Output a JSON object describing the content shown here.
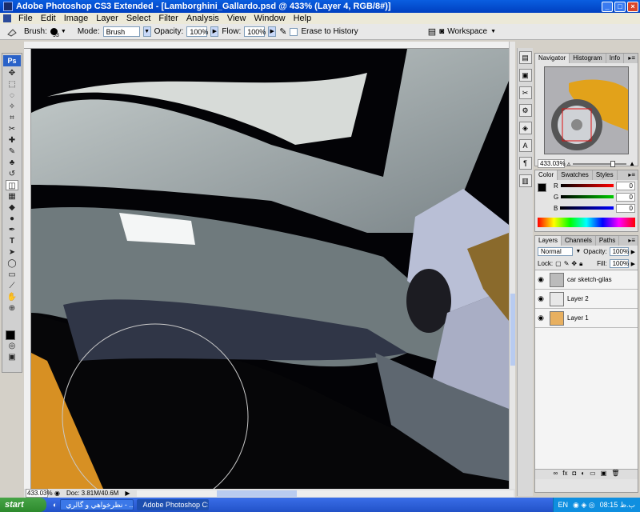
{
  "window": {
    "title": "Adobe Photoshop CS3 Extended - [Lamborghini_Gallardo.psd @ 433% (Layer 4, RGB/8#)]",
    "buttons": [
      "_",
      "□",
      "×"
    ]
  },
  "menu": [
    "File",
    "Edit",
    "Image",
    "Layer",
    "Select",
    "Filter",
    "Analysis",
    "View",
    "Window",
    "Help"
  ],
  "options": {
    "brush_label": "Brush:",
    "brush_size": "93",
    "mode_label": "Mode:",
    "mode_value": "Brush",
    "opacity_label": "Opacity:",
    "opacity_value": "100%",
    "flow_label": "Flow:",
    "flow_value": "100%",
    "erase_history_label": "Erase to History",
    "workspace_label": "Workspace"
  },
  "status": {
    "zoom": "433.03%",
    "doc": "Doc: 3.81M/40.6M"
  },
  "navigator": {
    "tabs": [
      "Navigator",
      "Histogram",
      "Info"
    ],
    "zoom": "433.03%"
  },
  "color_panel": {
    "tabs": [
      "Color",
      "Swatches",
      "Styles"
    ],
    "channels": [
      {
        "name": "R",
        "value": "0",
        "color": "#ff0000"
      },
      {
        "name": "G",
        "value": "0",
        "color": "#00c000"
      },
      {
        "name": "B",
        "value": "0",
        "color": "#0000ff"
      }
    ]
  },
  "layers_panel": {
    "tabs": [
      "Layers",
      "Channels",
      "Paths"
    ],
    "blend_mode": "Normal",
    "opacity_label": "Opacity:",
    "opacity_value": "100%",
    "lock_label": "Lock:",
    "fill_label": "Fill:",
    "fill_value": "100%",
    "layers": [
      {
        "name": "car sketch-gilas"
      },
      {
        "name": "Layer 2"
      },
      {
        "name": "Layer 1"
      }
    ]
  },
  "taskbar": {
    "start": "start",
    "tasks": [
      "نظرخواهي و گالري - ...",
      "Adobe Photoshop CS..."
    ],
    "lang": "EN",
    "clock": "08:15 ب.ظ"
  }
}
